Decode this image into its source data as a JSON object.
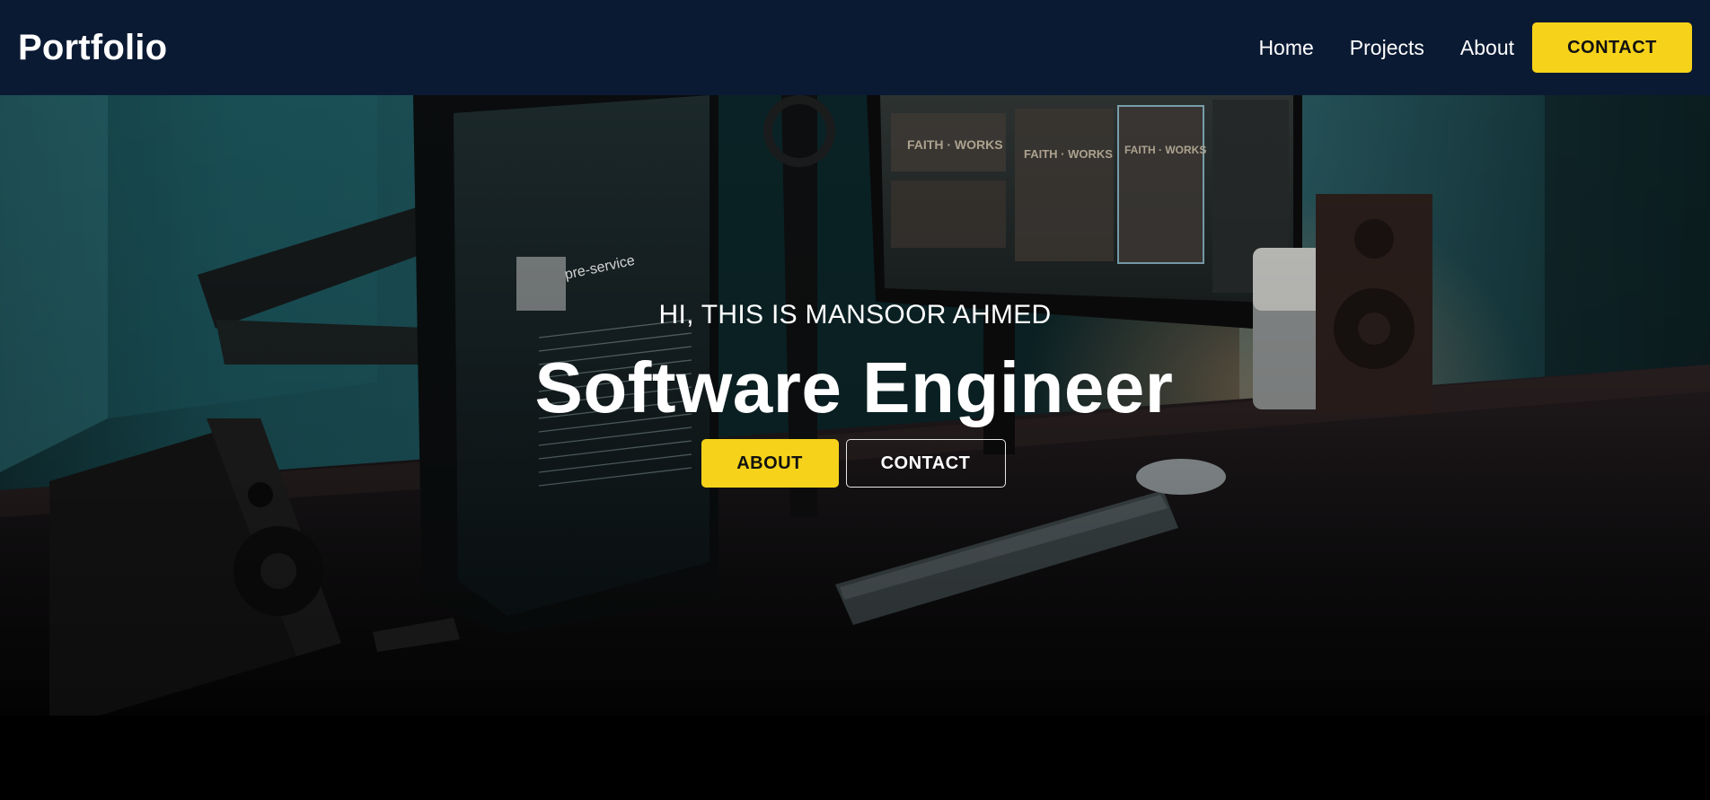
{
  "navbar": {
    "brand": "Portfolio",
    "links": [
      "Home",
      "Projects",
      "About"
    ],
    "cta_label": "CONTACT"
  },
  "hero": {
    "greeting": "HI, THIS IS MANSOOR AHMED",
    "title": "Software Engineer",
    "primary_button": "ABOUT",
    "secondary_button": "CONTACT",
    "background_scene": "desk-setup-with-monitors-photo"
  },
  "colors": {
    "navbar_bg": "#0b1a33",
    "accent": "#f6d31a",
    "text": "#ffffff",
    "page_bg": "#000000"
  }
}
